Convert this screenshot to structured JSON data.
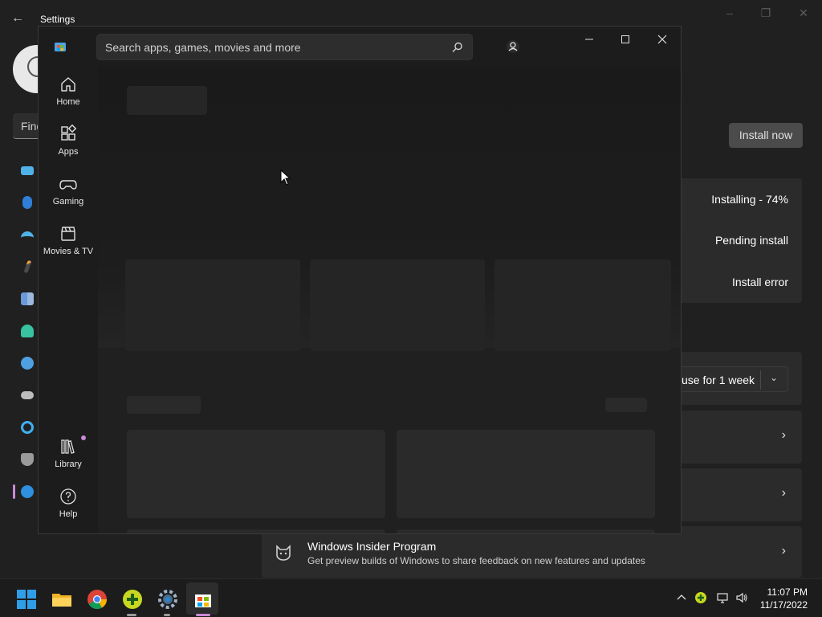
{
  "settings": {
    "title": "Settings",
    "search_text": "Find",
    "install_now_label": "Install now",
    "statuses": [
      "Installing - 74%",
      "Pending install",
      "Install error"
    ],
    "pause_label": "use for 1 week",
    "insider_title": "Windows Insider Program",
    "insider_desc": "Get preview builds of Windows to share feedback on new features and updates"
  },
  "store": {
    "search_placeholder": "Search apps, games, movies and more",
    "nav": [
      {
        "label": "Home",
        "icon": "home-icon"
      },
      {
        "label": "Apps",
        "icon": "apps-icon"
      },
      {
        "label": "Gaming",
        "icon": "gamepad-icon"
      },
      {
        "label": "Movies & TV",
        "icon": "clapperboard-icon"
      }
    ],
    "nav_bottom": [
      {
        "label": "Library",
        "icon": "library-icon"
      },
      {
        "label": "Help",
        "icon": "help-icon"
      }
    ]
  },
  "taskbar": {
    "apps": [
      "start-icon",
      "file-explorer-icon",
      "chrome-icon",
      "plus-app-icon",
      "settings-icon",
      "microsoft-store-icon"
    ],
    "time": "11:07 PM",
    "date": "11/17/2022"
  },
  "colors": {
    "accent": "#c98ad6",
    "background": "#202020",
    "card": "#2b2b2b"
  }
}
